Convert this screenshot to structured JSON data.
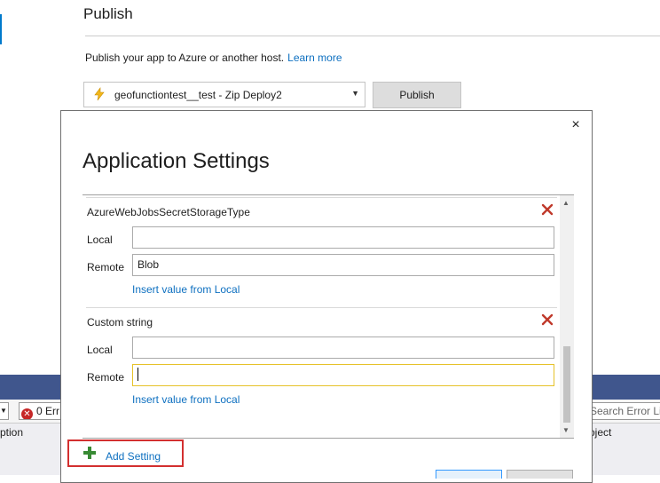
{
  "publish": {
    "title": "Publish",
    "description": "Publish your app to Azure or another host.",
    "learn_more": "Learn more",
    "profile": "geofunctiontest__test - Zip Deploy2",
    "publish_button": "Publish"
  },
  "error_list": {
    "errors": "0 Err",
    "search_placeholder": "Search Error List",
    "col_description": "ption",
    "col_project": "oject"
  },
  "dialog": {
    "title": "Application Settings",
    "close": "×",
    "local_label": "Local",
    "remote_label": "Remote",
    "insert_link": "Insert value from Local",
    "settings": [
      {
        "name": "",
        "local": "",
        "remote": ""
      },
      {
        "name": "AzureWebJobsSecretStorageType",
        "local": "",
        "remote": "Blob"
      },
      {
        "name": "Custom string",
        "local": "",
        "remote": ""
      }
    ],
    "add_setting": "Add Setting"
  },
  "colors": {
    "link": "#0e70c0",
    "delete_red": "#c0392b",
    "add_green": "#388a34",
    "highlight_border": "#d32f2f",
    "focus_border": "#e6c229"
  }
}
